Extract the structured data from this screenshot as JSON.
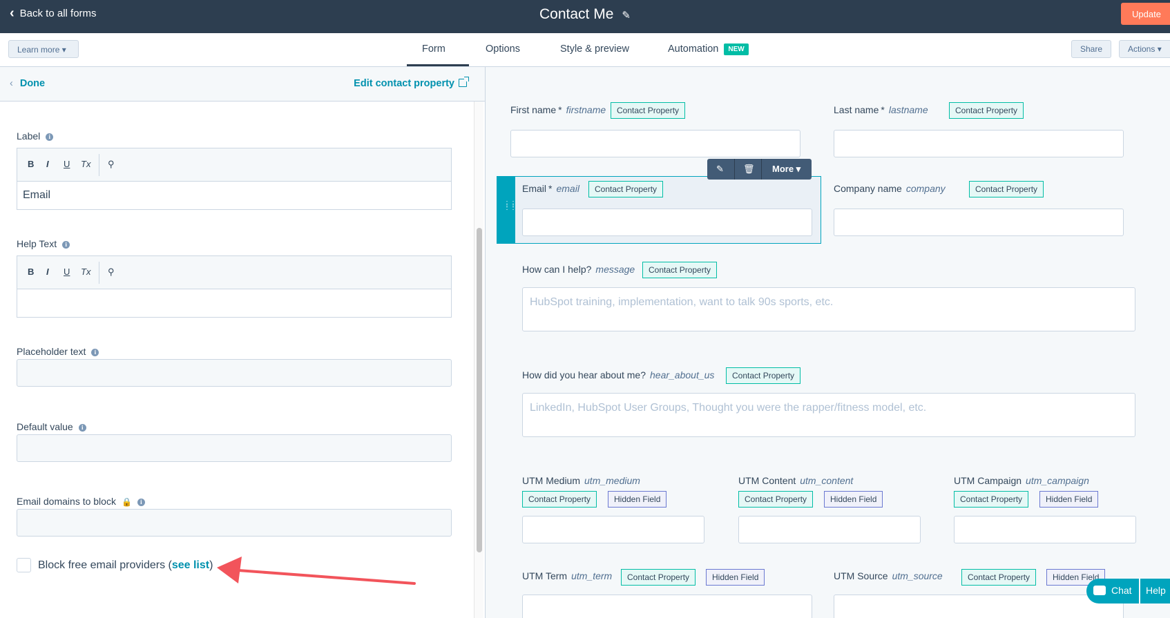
{
  "header": {
    "back_label": "Back to all forms",
    "title": "Contact Me",
    "update_label": "Update"
  },
  "tabs": {
    "learn_more": "Learn more",
    "items": [
      "Form",
      "Options",
      "Style & preview",
      "Automation"
    ],
    "new_badge": "NEW",
    "share": "Share",
    "actions": "Actions"
  },
  "left_panel": {
    "done": "Done",
    "edit_property": "Edit contact property",
    "label_title": "Label",
    "label_value": "Email",
    "help_text_title": "Help Text",
    "help_text_value": "",
    "placeholder_title": "Placeholder text",
    "default_value_title": "Default value",
    "email_domains_title": "Email domains to block",
    "block_free_text": "Block free email providers (",
    "see_list": "see list",
    "close_paren": ")",
    "rte_buttons": [
      "B",
      "I",
      "U",
      "Tx",
      "⚲"
    ]
  },
  "form": {
    "contact_property": "Contact Property",
    "hidden_field": "Hidden Field",
    "first_name": {
      "label": "First name",
      "req": "*",
      "internal": "firstname"
    },
    "last_name": {
      "label": "Last name",
      "req": "*",
      "internal": "lastname"
    },
    "email": {
      "label": "Email",
      "req": "*",
      "internal": "email"
    },
    "company": {
      "label": "Company name",
      "internal": "company"
    },
    "message": {
      "label": "How can I help?",
      "internal": "message",
      "placeholder": "HubSpot training, implementation, want to talk 90s sports, etc."
    },
    "hear": {
      "label": "How did you hear about me?",
      "internal": "hear_about_us",
      "placeholder": "LinkedIn, HubSpot User Groups, Thought you were the rapper/fitness model, etc."
    },
    "utm_medium": {
      "label": "UTM Medium",
      "internal": "utm_medium"
    },
    "utm_content": {
      "label": "UTM Content",
      "internal": "utm_content"
    },
    "utm_campaign": {
      "label": "UTM Campaign",
      "internal": "utm_campaign"
    },
    "utm_term": {
      "label": "UTM Term",
      "internal": "utm_term"
    },
    "utm_source": {
      "label": "UTM Source",
      "internal": "utm_source"
    },
    "toolbar_more": "More"
  },
  "widgets": {
    "chat": "Chat",
    "help": "Help"
  },
  "colors": {
    "topbar": "#2d3e50",
    "update": "#ff7a59",
    "accent_teal": "#00a4bd",
    "link": "#0091ae",
    "arrow": "#f2545b"
  }
}
